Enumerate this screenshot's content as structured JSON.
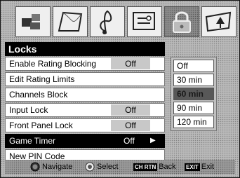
{
  "icons": [
    {
      "name": "picture-icon"
    },
    {
      "name": "display-icon"
    },
    {
      "name": "audio-icon"
    },
    {
      "name": "setup-icon"
    },
    {
      "name": "lock-icon",
      "active": true
    },
    {
      "name": "install-icon"
    }
  ],
  "menu": {
    "title": "Locks",
    "items": [
      {
        "label": "Enable Rating Blocking",
        "value": "Off"
      },
      {
        "label": "Edit Rating Limits",
        "value": ""
      },
      {
        "label": "Channels Block",
        "value": ""
      },
      {
        "label": "Input Lock",
        "value": "Off"
      },
      {
        "label": "Front Panel Lock",
        "value": "Off"
      },
      {
        "label": "Game Timer",
        "value": "Off",
        "selected": true
      },
      {
        "label": "New PIN Code",
        "value": ""
      }
    ]
  },
  "options": {
    "items": [
      "Off",
      "30 min",
      "60 min",
      "90 min",
      "120 min"
    ],
    "current": "60 min"
  },
  "footer": {
    "navigate": "Navigate",
    "select": "Select",
    "back_badge": "CH RTN",
    "back": "Back",
    "exit_badge": "EXIT",
    "exit": "Exit"
  },
  "colors": {
    "selected_bg": "#000000",
    "panel_bg": "#b9b9b9"
  }
}
